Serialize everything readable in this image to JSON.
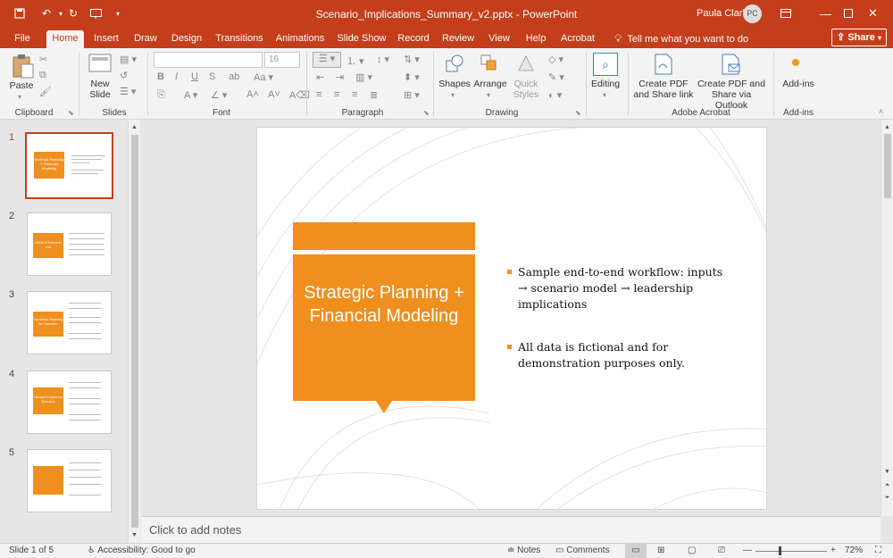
{
  "titlebar": {
    "title": "Scenario_Implications_Summary_v2.pptx  -  PowerPoint",
    "user_name": "Paula Clark",
    "user_initials": "PC"
  },
  "tabs": [
    "File",
    "Home",
    "Insert",
    "Draw",
    "Design",
    "Transitions",
    "Animations",
    "Slide Show",
    "Record",
    "Review",
    "View",
    "Help",
    "Acrobat"
  ],
  "tell_me": "Tell me what you want to do",
  "share_label": "Share",
  "ribbon": {
    "paste": "Paste",
    "new_slide_1": "New",
    "new_slide_2": "Slide",
    "font_name": "",
    "font_size": "16",
    "shapes": "Shapes",
    "arrange": "Arrange",
    "quick_styles_1": "Quick",
    "quick_styles_2": "Styles",
    "editing": "Editing",
    "create_pdf_share_link_1": "Create PDF",
    "create_pdf_share_link_2": "and Share link",
    "create_pdf_outlook_1": "Create PDF and",
    "create_pdf_outlook_2": "Share via Outlook",
    "addins": "Add-ins",
    "groups": {
      "clipboard": "Clipboard",
      "slides": "Slides",
      "font": "Font",
      "paragraph": "Paragraph",
      "drawing": "Drawing",
      "adobe": "Adobe Acrobat",
      "addins": "Add-ins"
    }
  },
  "thumbnails": [
    {
      "num": "1",
      "title": "Strategic Planning + Financial Modeling"
    },
    {
      "num": "2",
      "title": "What-if Scenario Set"
    },
    {
      "num": "3",
      "title": "Workflow Planning for Scenario"
    },
    {
      "num": "4",
      "title": "Budget Impact by Scenario"
    },
    {
      "num": "5",
      "title": ""
    }
  ],
  "slide": {
    "title": "Strategic Planning + Financial Modeling",
    "bullet_1": "Sample end-to-end workflow: inputs → scenario model → leadership implications",
    "bullet_2": "All data is fictional and for demonstration purposes only."
  },
  "notes_placeholder": "Click to add notes",
  "status": {
    "slide_of": "Slide 1 of 5",
    "accessibility": "Accessibility: Good to go",
    "notes": "Notes",
    "comments": "Comments",
    "zoom": "72%"
  },
  "colors": {
    "brand": "#c43e1c",
    "accent_orange": "#ef8f1e"
  }
}
